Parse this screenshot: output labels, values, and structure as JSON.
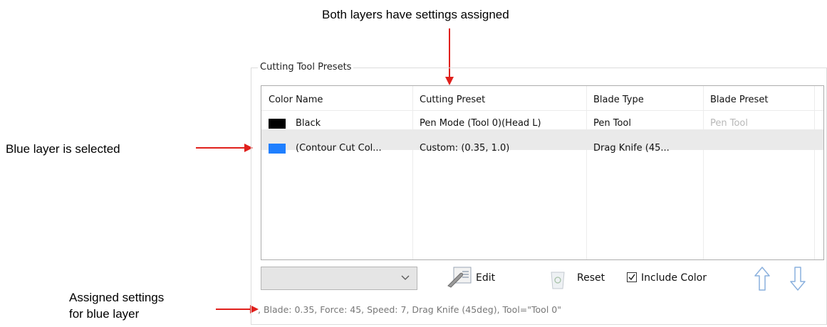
{
  "annotations": {
    "top": "Both layers have settings assigned",
    "left": "Blue layer is selected",
    "bottom_line1": "Assigned settings",
    "bottom_line2": "for blue layer"
  },
  "group": {
    "title": "Cutting Tool Presets"
  },
  "table": {
    "columns": [
      "Color Name",
      "Cutting Preset",
      "Blade Type",
      "Blade Preset"
    ],
    "rows": [
      {
        "swatch": "#000000",
        "color_name": "Black",
        "cutting_preset": "Pen Mode (Tool 0)(Head L)",
        "blade_type": "Pen Tool",
        "blade_preset": "Pen Tool",
        "selected": false
      },
      {
        "swatch": "#1f7fff",
        "color_name": "(Contour Cut Col...",
        "cutting_preset": "Custom: (0.35, 1.0)",
        "blade_type": "Drag Knife (45...",
        "blade_preset": "",
        "selected": true
      }
    ]
  },
  "toolbar": {
    "preset_combo_value": "",
    "edit_label": "Edit",
    "reset_label": "Reset",
    "include_color_label": "Include Color",
    "include_color_checked": true
  },
  "status_text": ", Blade: 0.35, Force: 45, Speed: 7, Drag Knife (45deg), Tool=\"Tool 0\"",
  "colors": {
    "arrow": "#e0201c",
    "selection": "#eaeaea",
    "arrow_icon": "#8ab0dd"
  }
}
